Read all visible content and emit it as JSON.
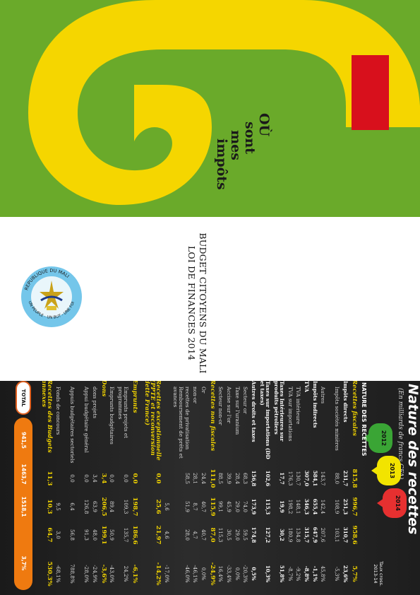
{
  "cover": {
    "slogan": [
      "OÙ",
      "sont",
      "mes",
      "impôts"
    ],
    "colors": {
      "green": "#6aaa2a",
      "yellow": "#f5d600",
      "red": "#d8101c"
    }
  },
  "middle": {
    "emblem_top_text": "REPUBLIQUE DU MALI",
    "emblem_bottom_text": "UN PEUPLE - UN BUT - UNE FOI",
    "title_line1": "BUDGET CITOYENS DU MALI",
    "title_line2": "LOI DE FINANCES 2014"
  },
  "revenue_panel": {
    "title": "Nature des recettes",
    "subtitle": "(En milliards de francs CFA)",
    "years": [
      "2012",
      "2013",
      "2014"
    ],
    "header_label": "NATURE DES RECETTES",
    "header_rate": "Taux cross. 2013-14",
    "rows": [
      {
        "type": "major",
        "label": "Recettes fiscales",
        "v": [
          "815,8",
          "996,7",
          "958,6",
          "5,7%"
        ]
      },
      {
        "type": "sub",
        "label": "Impôts directs",
        "v": [
          "231,7",
          "251,3",
          "310,7",
          "23,6%"
        ]
      },
      {
        "type": "item",
        "label": "Impôts sociétés minières",
        "v": [
          "88,0",
          "108,9",
          "103,1",
          "-5,3%"
        ]
      },
      {
        "type": "item",
        "label": "Autres",
        "v": [
          "143,7",
          "142,4",
          "207,6",
          "45,8%"
        ]
      },
      {
        "type": "sub",
        "label": "Impôts indirects",
        "v": [
          "584,1",
          "655,4",
          "647,9",
          "-1,1%"
        ]
      },
      {
        "type": "sub",
        "label": "TVA",
        "v": [
          "307,0",
          "346,3",
          "315,7",
          "-8,8%"
        ]
      },
      {
        "type": "item",
        "label": "TVA intérieure",
        "v": [
          "130,7",
          "148,1",
          "134,8",
          "-9,2%"
        ]
      },
      {
        "type": "item",
        "label": "TVA sur importations",
        "v": [
          "176,3",
          "198,2",
          "180,9",
          "-8,7%"
        ]
      },
      {
        "type": "sub",
        "label": "Taxes Intérieures sur produits pétroliers",
        "v": [
          "17,7",
          "19,9",
          "30,2",
          "51,8%"
        ]
      },
      {
        "type": "sub",
        "label": "Taxes sur importations (DD et taxes)",
        "v": [
          "102,6",
          "115,3",
          "127,2",
          "10,3%"
        ]
      },
      {
        "type": "sub",
        "label": "Autres droits et taxes",
        "v": [
          "156,8",
          "173,9",
          "174,8",
          "0,5%"
        ]
      },
      {
        "type": "item",
        "label": "Secteur or",
        "v": [
          "68,3",
          "74,0",
          "59,5",
          "-20,3%"
        ]
      },
      {
        "type": "item",
        "label": "Taxe sur l'uranium",
        "v": [
          "28,4",
          "29,0",
          "29,0",
          "0,0%"
        ]
      },
      {
        "type": "item",
        "label": "Accise sur l'or",
        "v": [
          "39,9",
          "45,9",
          "30,5",
          "-33,4%"
        ]
      },
      {
        "type": "item",
        "label": "Secteur non-or",
        "v": [
          "88,5",
          "99,1",
          "115,3",
          "16,4%"
        ]
      },
      {
        "type": "major",
        "label": "Recettes non fiscales",
        "v": [
          "111,0",
          "115,9",
          "87,0",
          "-24,9%"
        ]
      },
      {
        "type": "item",
        "label": "Or",
        "v": [
          "24,4",
          "40,7",
          "40,7",
          "0,0%"
        ]
      },
      {
        "type": "item",
        "label": "non-or",
        "v": [
          "28,1",
          "8,7",
          "4,7",
          "-46,1%"
        ]
      },
      {
        "type": "item",
        "label": "recettes de privatisation Remboursement de prêts et avances",
        "v": [
          "58,5",
          "51,9",
          "28,0",
          "-46,0%"
        ]
      },
      {
        "type": "item",
        "label": "",
        "v": [
          "",
          "5,6",
          "4,6",
          "-17,0%"
        ]
      },
      {
        "type": "major",
        "label": "Recettes exceptionnelle (PPTE et reconversion dette France)",
        "v": [
          "0,0",
          "25,6",
          "21,97",
          "-14,2%"
        ]
      },
      {
        "type": "major",
        "label": "Emprunts",
        "v": [
          "0,0",
          "198,7",
          "186,6",
          "-6,1%"
        ]
      },
      {
        "type": "item",
        "label": "Emprunts projets et programmes",
        "v": [
          "0,0",
          "109,3",
          "135,7",
          "24,2%"
        ]
      },
      {
        "type": "item",
        "label": "Emprunts budgétaires",
        "v": [
          "0,0",
          "89,4",
          "50,9",
          "-43,0%"
        ]
      },
      {
        "type": "major",
        "label": "Dons",
        "v": [
          "3,4",
          "206,5",
          "199,1",
          "-3,6%"
        ]
      },
      {
        "type": "item",
        "label": "dons projets",
        "v": [
          "3,4",
          "63,9",
          "48,0",
          "-24,9%"
        ]
      },
      {
        "type": "item",
        "label": "Appui budgétaire général",
        "v": [
          "0,0",
          "126,8",
          "91,3",
          "-28,0%"
        ]
      },
      {
        "type": "item",
        "label": "Appuis budgétaires sectoriels",
        "v": [
          "0,0",
          "6,4",
          "56,8",
          "788,8%"
        ]
      },
      {
        "type": "item",
        "label": "Fonds de concours",
        "v": [
          "",
          "9,5",
          "3,0",
          "-68,1%"
        ]
      },
      {
        "type": "major",
        "label": "Recettes des Budgets annexes",
        "v": [
          "11,3",
          "10,3",
          "64,7",
          "530,3%"
        ]
      }
    ],
    "total_label": "TOTAL",
    "total_values": [
      "941,5",
      "1463,7",
      "1518,1",
      "3,7%"
    ]
  }
}
